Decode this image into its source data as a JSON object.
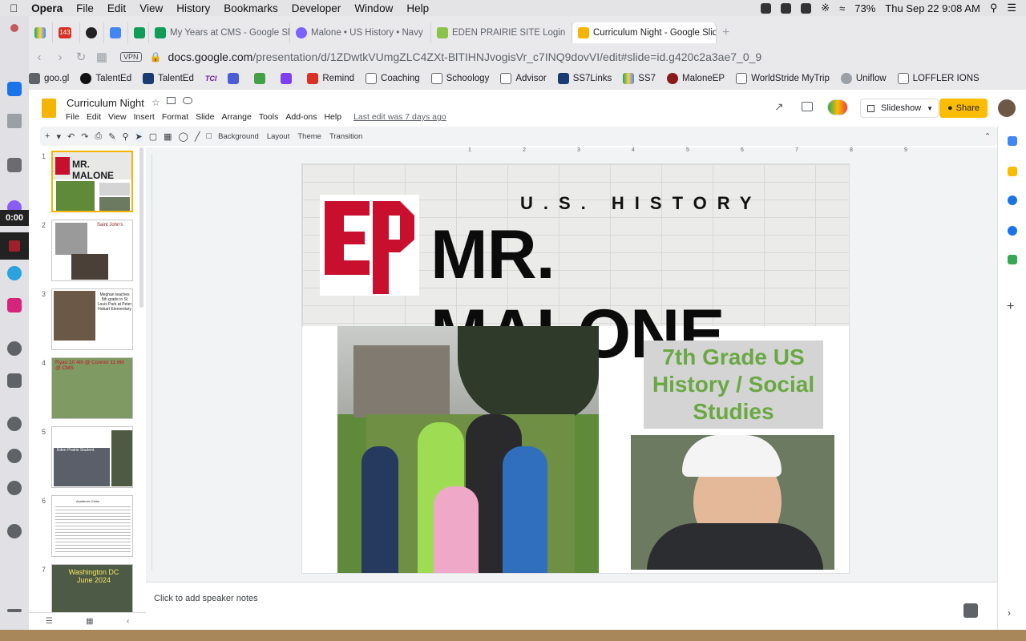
{
  "menubar": {
    "app": "Opera",
    "items": [
      "File",
      "Edit",
      "View",
      "History",
      "Bookmarks",
      "Developer",
      "Window",
      "Help"
    ],
    "battery": "73%",
    "clock": "Thu Sep 22  9:08 AM"
  },
  "tabs": [
    {
      "label": "143",
      "kind": "badge"
    },
    {
      "label": "My Years at CMS - Google She"
    },
    {
      "label": "Malone • US History • Navy"
    },
    {
      "label": "EDEN PRAIRIE SITE Login"
    },
    {
      "label": "Curriculum Night - Google Slid",
      "active": true
    }
  ],
  "address": {
    "vpn": "VPN",
    "domain": "docs.google.com",
    "path": "/presentation/d/1ZDwtkVUmgZLC4ZXt-BlTIHNJvogisVr_c7INQ9dovVI/edit#slide=id.g420c2a3ae7_0_9"
  },
  "bookmarks": [
    "goo.gl",
    "TalentEd",
    "TalentEd",
    "TCI",
    "Remind",
    "Coaching",
    "Schoology",
    "Advisor",
    "SS7Links",
    "SS7",
    "MaloneEP",
    "WorldStride MyTrip",
    "Uniflow",
    "LOFFLER IONS"
  ],
  "sidebar": {
    "timer": "0:00"
  },
  "doc": {
    "title": "Curriculum Night",
    "menus": [
      "File",
      "Edit",
      "View",
      "Insert",
      "Format",
      "Slide",
      "Arrange",
      "Tools",
      "Add-ons",
      "Help"
    ],
    "last_edit": "Last edit was 7 days ago",
    "slideshow": "Slideshow",
    "share": "Share"
  },
  "toolbar": {
    "background": "Background",
    "layout": "Layout",
    "theme": "Theme",
    "transition": "Transition"
  },
  "ruler": [
    "1",
    "2",
    "3",
    "4",
    "5",
    "6",
    "7",
    "8",
    "9"
  ],
  "thumbnails": [
    {
      "num": "1",
      "caption": "MR. MALONE"
    },
    {
      "num": "2",
      "caption": "Saint John's"
    },
    {
      "num": "3",
      "caption": "Meghan teaches 5th grade in St Louis Park at Peter Hobart Elementary"
    },
    {
      "num": "4",
      "caption": "Ryan 10 4th @ Connor 11 6th @ CMS"
    },
    {
      "num": "5",
      "caption": "Eden Prairie Student"
    },
    {
      "num": "6",
      "caption": "Academic Clubs"
    },
    {
      "num": "7",
      "caption": "Washington DC June 2024"
    }
  ],
  "slide": {
    "subtitle": "U.S. HISTORY",
    "title": "MR. MALONE",
    "logo": "EP",
    "grade_box": "7th Grade US History / Social Studies"
  },
  "notes": {
    "placeholder": "Click to add speaker notes"
  },
  "colors": {
    "accent": "#fbbc04",
    "logo_red": "#c8102e",
    "grade_green": "#6aa843"
  }
}
